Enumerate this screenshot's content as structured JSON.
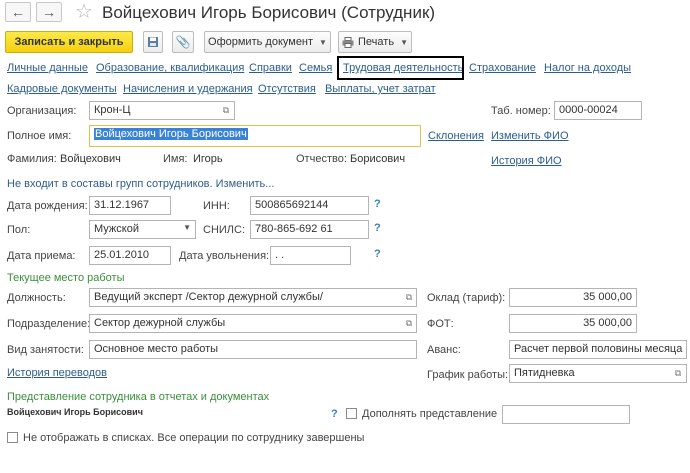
{
  "header": {
    "title": "Войцехович Игорь Борисович (Сотрудник)",
    "back_icon": "arrow-left-icon",
    "forward_icon": "arrow-right-icon",
    "star_icon": "star-icon"
  },
  "toolbar": {
    "save_close_label": "Записать и закрыть",
    "oformit_label": "Оформить документ",
    "print_label": "Печать"
  },
  "tabs": [
    "Личные данные",
    "Образование, квалификация",
    "Справки",
    "Семья",
    "Трудовая деятельность",
    "Страхование",
    "Налог на доходы",
    "Кадровые документы",
    "Начисления и удержания",
    "Отсутствия",
    "Выплаты, учет затрат"
  ],
  "form": {
    "org_label": "Организация:",
    "org_value": "Крон-Ц",
    "tab_num_label": "Таб. номер:",
    "tab_num_value": "0000-00024",
    "fullname_label": "Полное имя:",
    "fullname_value": "Войцехович Игорь Борисович",
    "sklon_link": "Склонения",
    "izm_fio_link": "Изменить ФИО",
    "familia_label": "Фамилия:",
    "familia_value": "Войцехович",
    "imya_label": "Имя:",
    "imya_value": "Игорь",
    "otchestvo_label": "Отчество:",
    "otchestvo_value": "Борисович",
    "istoria_fio_link": "История ФИО",
    "groups_text": "Не входит в составы групп сотрудников. Изменить...",
    "birth_label": "Дата рождения:",
    "birth_value": "31.12.1967",
    "inn_label": "ИНН:",
    "inn_value": "500865692144",
    "pol_label": "Пол:",
    "pol_value": "Мужской",
    "snils_label": "СНИЛС:",
    "snils_value": "780-865-692 61",
    "priem_label": "Дата приема:",
    "priem_value": "25.01.2010",
    "uvol_label": "Дата увольнения:",
    "uvol_value": " .  .",
    "q_mark": "?"
  },
  "work": {
    "section_title": "Текущее место работы",
    "dolzh_label": "Должность:",
    "dolzh_value": "Ведущий эксперт /Сектор дежурной службы/",
    "oklad_label": "Оклад (тариф):",
    "oklad_value": "35 000,00",
    "podr_label": "Подразделение:",
    "podr_value": "Сектор дежурной службы",
    "fot_label": "ФОТ:",
    "fot_value": "35 000,00",
    "vid_label": "Вид занятости:",
    "vid_value": "Основное место работы",
    "avans_label": "Аванс:",
    "avans_value": "Расчет первой половины месяца",
    "istoria_link": "История переводов",
    "grafik_label": "График работы:",
    "grafik_value": "Пятидневка"
  },
  "repr": {
    "section_title": "Представление сотрудника в отчетах и документах",
    "name": "Войцехович Игорь Борисович",
    "dopoln_label": "Дополнять представление",
    "hide_label": "Не отображать в списках. Все операции по сотруднику завершены"
  }
}
